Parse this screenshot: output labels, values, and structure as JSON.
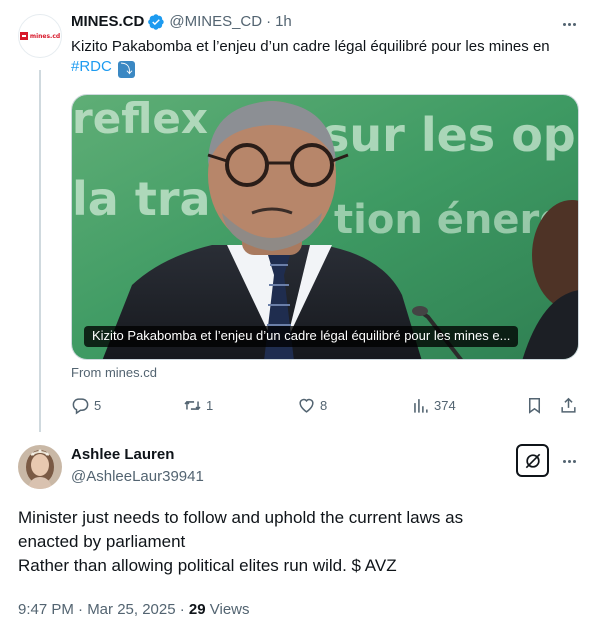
{
  "tweet": {
    "author_name": "MINES.CD",
    "author_handle": "@MINES_CD",
    "separator": "·",
    "time": "1h",
    "avatar_logo_text": "mines.cd",
    "text": "Kizito Pakabomba et l’enjeu d’un cadre légal équilibré pour les mines en ",
    "hashtag": "#RDC",
    "emoji": "⤵",
    "card": {
      "background_words": [
        "reflex",
        "sur les opp",
        "la tra",
        "tion énerg"
      ],
      "caption": "Kizito Pakabomba et l’enjeu d’un cadre légal équilibré pour les mines e..."
    },
    "from": "From mines.cd",
    "actions": {
      "replies": "5",
      "reposts": "1",
      "likes": "8",
      "views": "374"
    }
  },
  "reply": {
    "author_name": "Ashlee Lauren",
    "author_handle": "@AshleeLaur39941",
    "line1": "Minister just needs to follow and uphold the current laws as",
    "line2": "enacted by parliament",
    "line3": "Rather than allowing political elites run wild. $ AVZ",
    "time": "9:47 PM · Mar 25, 2025 · ",
    "views_count": "29",
    "views_label": " Views"
  },
  "icons": {
    "verified": "verified-badge-icon",
    "reply": "reply-icon",
    "repost": "repost-icon",
    "like": "heart-icon",
    "views": "views-icon",
    "bookmark": "bookmark-icon",
    "share": "share-icon",
    "grok": "grok-icon",
    "more": "more-icon"
  },
  "colors": {
    "accent": "#1d9bf0",
    "text": "#0f1419",
    "secondary": "#536471",
    "brand_red": "#d7182a"
  }
}
